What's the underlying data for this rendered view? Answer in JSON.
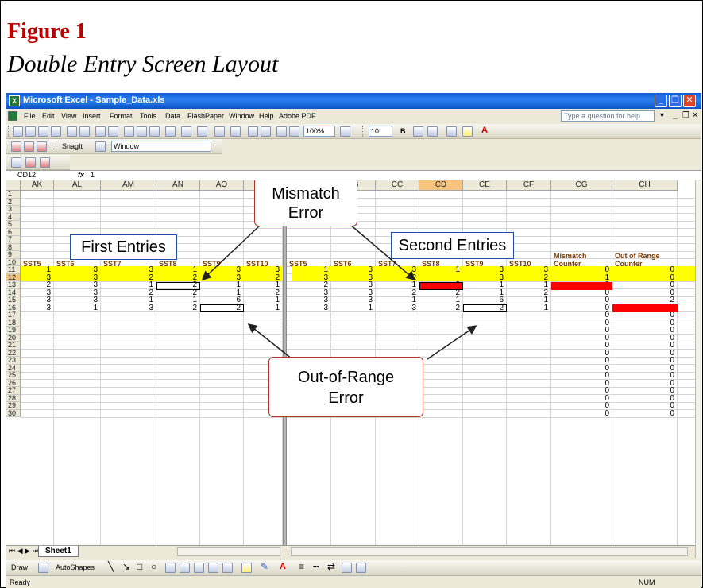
{
  "figure": {
    "title": "Figure 1",
    "subtitle": "Double Entry Screen Layout"
  },
  "window": {
    "title": "Microsoft Excel - Sample_Data.xls"
  },
  "menu": {
    "items": [
      "File",
      "Edit",
      "View",
      "Insert",
      "Format",
      "Tools",
      "Data",
      "FlashPaper",
      "Window",
      "Help",
      "Adobe PDF"
    ],
    "help_placeholder": "Type a question for help"
  },
  "toolbar": {
    "zoom": "100%",
    "font_size": "10",
    "snagit": "SnagIt",
    "window_select": "Window"
  },
  "formula_bar": {
    "name_box": "CD12",
    "fx": "fx",
    "value": "1"
  },
  "columns_left": [
    "AK",
    "AL",
    "AM",
    "AN",
    "AO",
    "AP"
  ],
  "columns_right": [
    "CA",
    "CB",
    "CC",
    "CD",
    "CE",
    "CF",
    "CG",
    "CH"
  ],
  "row_numbers": [
    "1",
    "2",
    "3",
    "4",
    "5",
    "6",
    "7",
    "8",
    "9",
    "10",
    "11",
    "12",
    "13",
    "14",
    "15",
    "16",
    "17",
    "18",
    "19",
    "20",
    "21",
    "22",
    "23",
    "24",
    "25",
    "26",
    "27",
    "28",
    "29",
    "30"
  ],
  "headers_left": [
    "SST5",
    "SST6",
    "SST7",
    "SST8",
    "SST9",
    "SST10"
  ],
  "headers_right": [
    "SST5",
    "SST6",
    "SST7",
    "SST8",
    "SST9",
    "SST10"
  ],
  "counter_headers": {
    "mismatch_1": "Mismatch",
    "mismatch_2": "Counter",
    "range_1": "Out of Range",
    "range_2": "Counter"
  },
  "first_entries": [
    [
      1,
      3,
      3,
      1,
      3,
      3
    ],
    [
      3,
      3,
      2,
      2,
      3,
      2
    ],
    [
      2,
      3,
      1,
      2,
      1,
      1
    ],
    [
      3,
      3,
      2,
      2,
      1,
      2
    ],
    [
      3,
      3,
      1,
      1,
      6,
      1
    ],
    [
      3,
      1,
      3,
      2,
      2,
      1
    ]
  ],
  "second_entries": [
    [
      1,
      3,
      3,
      1,
      3,
      3
    ],
    [
      3,
      3,
      2,
      "",
      3,
      2
    ],
    [
      2,
      3,
      1,
      2,
      1,
      1
    ],
    [
      3,
      3,
      2,
      2,
      1,
      2
    ],
    [
      3,
      3,
      1,
      1,
      6,
      1
    ],
    [
      3,
      1,
      3,
      2,
      2,
      1
    ]
  ],
  "mismatch_counter": [
    0,
    1,
    0,
    0,
    0,
    0,
    0,
    0,
    0,
    0,
    0,
    0,
    0,
    0,
    0,
    0,
    0,
    0,
    0,
    0
  ],
  "range_counter": [
    0,
    0,
    0,
    0,
    2,
    0,
    0,
    0,
    0,
    0,
    0,
    0,
    0,
    0,
    0,
    0,
    0,
    0,
    0,
    0
  ],
  "callouts": {
    "first": "First Entries",
    "second": "Second Entries",
    "mismatch_1": "Mismatch",
    "mismatch_2": "Error",
    "range_1": "Out-of-Range",
    "range_2": "Error"
  },
  "sheet_tab": "Sheet1",
  "drawbar": {
    "draw": "Draw",
    "autoshapes": "AutoShapes"
  },
  "status": {
    "left": "Ready",
    "right": "NUM"
  },
  "colors": {
    "header_yellow": "#ffff00",
    "error_red": "#ff0000",
    "title_red": "#c00000",
    "selected_header": "#f8c37a"
  }
}
